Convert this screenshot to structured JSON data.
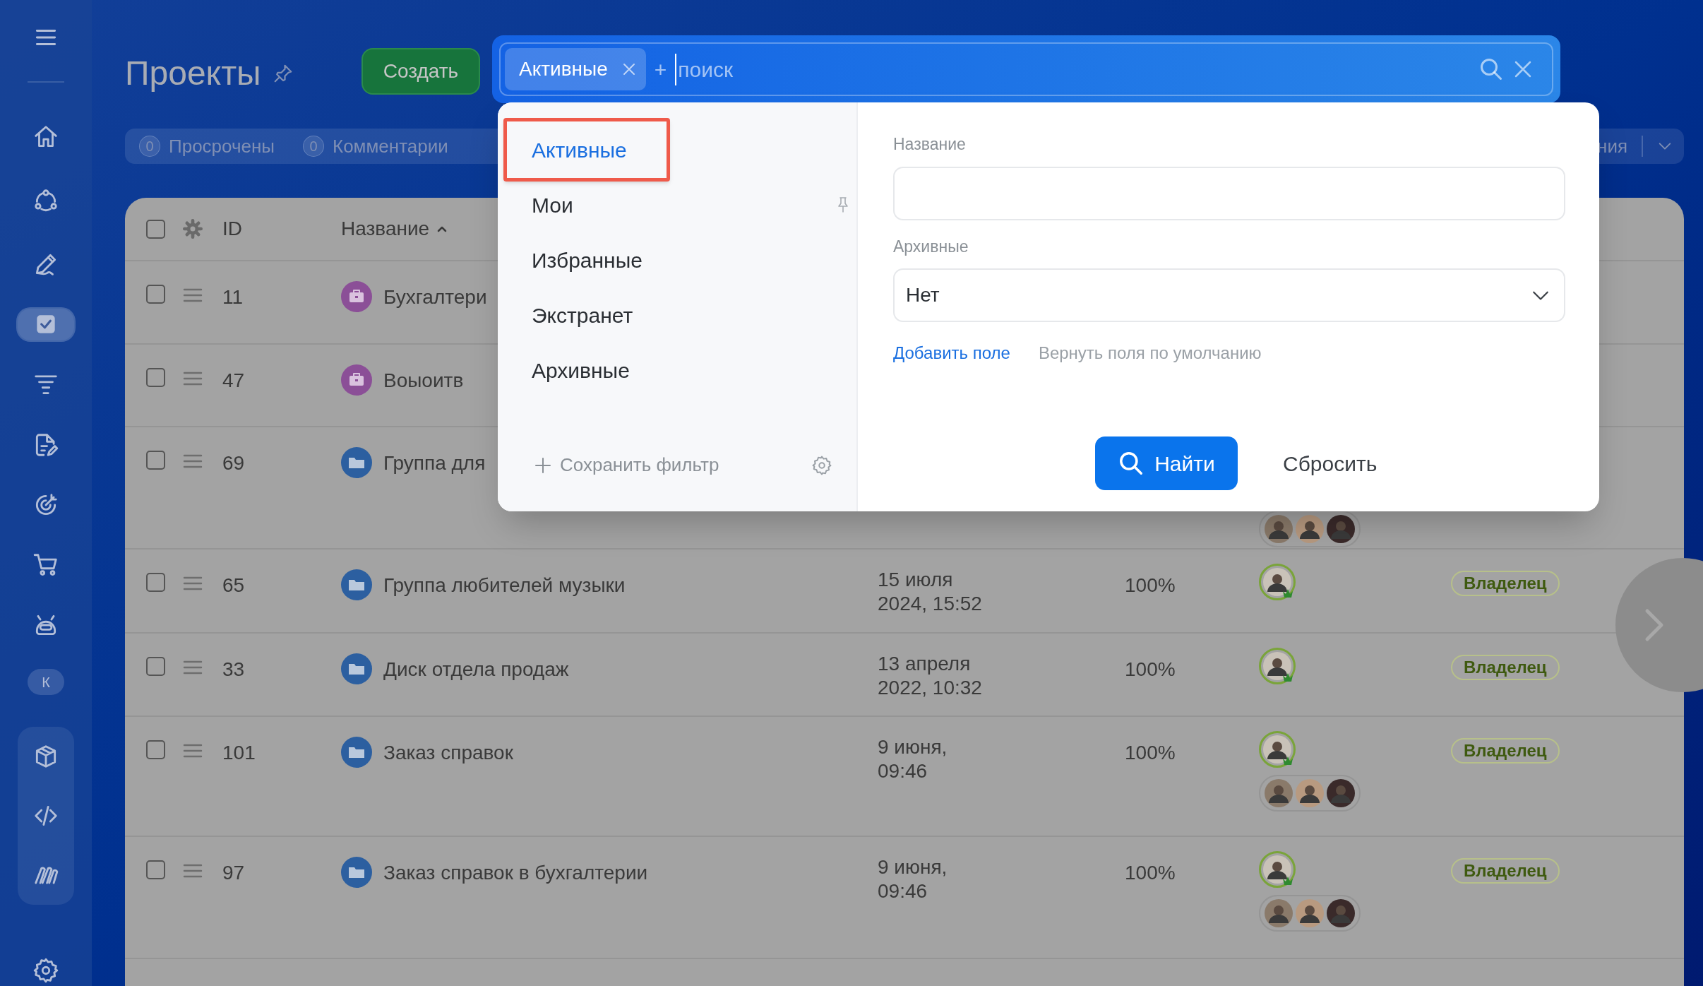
{
  "sidebar": {
    "items": [
      {
        "kind": "icon",
        "selected": false
      },
      {
        "kind": "icon",
        "selected": false
      },
      {
        "kind": "icon",
        "selected": false
      },
      {
        "kind": "icon",
        "selected": false
      },
      {
        "kind": "icon",
        "selected": true
      },
      {
        "kind": "icon",
        "selected": false
      },
      {
        "kind": "icon",
        "selected": false
      },
      {
        "kind": "icon",
        "selected": false
      },
      {
        "kind": "icon",
        "selected": false
      },
      {
        "kind": "icon",
        "selected": false
      },
      {
        "kind": "avatar",
        "label": "К"
      },
      {
        "kind": "icon",
        "selected": false
      },
      {
        "kind": "icon",
        "selected": false
      },
      {
        "kind": "icon",
        "selected": false
      },
      {
        "kind": "icon",
        "selected": false
      }
    ]
  },
  "header": {
    "title": "Проекты",
    "create_button": "Создать"
  },
  "search": {
    "chip": "Активные",
    "prefix": "+",
    "placeholder": "поиск"
  },
  "counters": [
    {
      "count": "0",
      "label": "Просрочены"
    },
    {
      "count": "0",
      "label": "Комментарии"
    }
  ],
  "counters_right": "ния",
  "table": {
    "all_checked": false,
    "columns": [
      {
        "label": "ID",
        "sorted": false
      },
      {
        "label": "Название",
        "sorted": true
      }
    ],
    "rows": [
      {
        "id": "11",
        "checked": false,
        "kind": "company",
        "name": "Бухгалтери"
      },
      {
        "id": "47",
        "checked": false,
        "kind": "company",
        "name": "Воыоитв"
      },
      {
        "id": "69",
        "checked": false,
        "kind": "folder",
        "name": "Группа для",
        "avatar_group": true
      },
      {
        "id": "65",
        "checked": false,
        "kind": "folder",
        "name": "Группа любителей музыки",
        "date": "15 июля 2024, 15:52",
        "progress": "100%",
        "owner_avatar": true,
        "avatar_group": false,
        "role": "Владелец"
      },
      {
        "id": "33",
        "checked": false,
        "kind": "folder",
        "name": "Диск отдела продаж",
        "date": "13 апреля 2022, 10:32",
        "progress": "100%",
        "owner_avatar": true,
        "avatar_group": false,
        "role": "Владелец"
      },
      {
        "id": "101",
        "checked": false,
        "kind": "folder",
        "name": "Заказ справок",
        "date": "9 июня, 09:46",
        "progress": "100%",
        "owner_avatar": true,
        "avatar_group": true,
        "role": "Владелец"
      },
      {
        "id": "97",
        "checked": false,
        "kind": "folder",
        "name": "Заказ справок в бухгалтерии",
        "date": "9 июня, 09:46",
        "progress": "100%",
        "owner_avatar": true,
        "avatar_group": true,
        "role": "Владелец"
      }
    ]
  },
  "filter": {
    "presets": [
      {
        "label": "Активные",
        "selected": true,
        "highlighted": true,
        "pinned": false
      },
      {
        "label": "Мои",
        "selected": false,
        "highlighted": false,
        "pinned": true
      },
      {
        "label": "Избранные",
        "selected": false,
        "highlighted": false,
        "pinned": false
      },
      {
        "label": "Экстранет",
        "selected": false,
        "highlighted": false,
        "pinned": false
      },
      {
        "label": "Архивные",
        "selected": false,
        "highlighted": false,
        "pinned": false
      }
    ],
    "save_filter": "Сохранить фильтр",
    "fields": [
      {
        "kind": "text",
        "label": "Название"
      },
      {
        "kind": "select",
        "label": "Архивные",
        "value": "Нет"
      }
    ],
    "add_field": "Добавить поле",
    "reset_fields": "Вернуть поля по умолчанию",
    "find_button": "Найти",
    "reset_button": "Сбросить"
  }
}
